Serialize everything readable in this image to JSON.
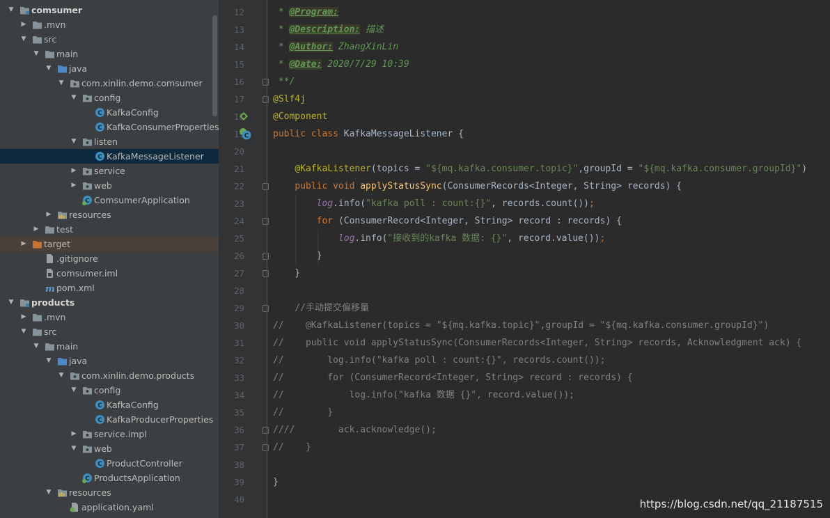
{
  "tree": [
    {
      "label": "comsumer",
      "icon": "module-folder-icon",
      "arrow": "▼",
      "level": 0,
      "bold": true
    },
    {
      "label": ".mvn",
      "icon": "folder-icon",
      "arrow": "▶",
      "level": 1
    },
    {
      "label": "src",
      "icon": "folder-icon",
      "arrow": "▼",
      "level": 1
    },
    {
      "label": "main",
      "icon": "folder-icon",
      "arrow": "▼",
      "level": 2
    },
    {
      "label": "java",
      "icon": "source-folder-icon",
      "arrow": "▼",
      "level": 3
    },
    {
      "label": "com.xinlin.demo.comsumer",
      "icon": "package-icon",
      "arrow": "▼",
      "level": 4
    },
    {
      "label": "config",
      "icon": "package-icon",
      "arrow": "▼",
      "level": 5
    },
    {
      "label": "KafkaConfig",
      "icon": "class-icon",
      "arrow": "",
      "level": 6
    },
    {
      "label": "KafkaConsumerProperties",
      "icon": "class-icon",
      "arrow": "",
      "level": 6
    },
    {
      "label": "listen",
      "icon": "package-icon",
      "arrow": "▼",
      "level": 5
    },
    {
      "label": "KafkaMessageListener",
      "icon": "class-icon",
      "arrow": "",
      "level": 6,
      "selected": true
    },
    {
      "label": "service",
      "icon": "package-icon",
      "arrow": "▶",
      "level": 5
    },
    {
      "label": "web",
      "icon": "package-icon",
      "arrow": "▶",
      "level": 5
    },
    {
      "label": "ComsumerApplication",
      "icon": "spring-class-icon",
      "arrow": "",
      "level": 5
    },
    {
      "label": "resources",
      "icon": "resources-folder-icon",
      "arrow": "▶",
      "level": 3
    },
    {
      "label": "test",
      "icon": "folder-icon",
      "arrow": "▶",
      "level": 2
    },
    {
      "label": "target",
      "icon": "excluded-folder-icon",
      "arrow": "▶",
      "level": 1,
      "highlight": true
    },
    {
      "label": ".gitignore",
      "icon": "file-icon",
      "arrow": "",
      "level": 2
    },
    {
      "label": "comsumer.iml",
      "icon": "iml-file-icon",
      "arrow": "",
      "level": 2
    },
    {
      "label": "pom.xml",
      "icon": "maven-icon",
      "arrow": "",
      "level": 2
    },
    {
      "label": "products",
      "icon": "module-folder-icon",
      "arrow": "▼",
      "level": 0,
      "bold": true
    },
    {
      "label": ".mvn",
      "icon": "folder-icon",
      "arrow": "▶",
      "level": 1
    },
    {
      "label": "src",
      "icon": "folder-icon",
      "arrow": "▼",
      "level": 1
    },
    {
      "label": "main",
      "icon": "folder-icon",
      "arrow": "▼",
      "level": 2
    },
    {
      "label": "java",
      "icon": "source-folder-icon",
      "arrow": "▼",
      "level": 3
    },
    {
      "label": "com.xinlin.demo.products",
      "icon": "package-icon",
      "arrow": "▼",
      "level": 4
    },
    {
      "label": "config",
      "icon": "package-icon",
      "arrow": "▼",
      "level": 5
    },
    {
      "label": "KafkaConfig",
      "icon": "class-icon",
      "arrow": "",
      "level": 6
    },
    {
      "label": "KafkaProducerProperties",
      "icon": "class-icon",
      "arrow": "",
      "level": 6
    },
    {
      "label": "service.impl",
      "icon": "package-icon",
      "arrow": "▶",
      "level": 5
    },
    {
      "label": "web",
      "icon": "package-icon",
      "arrow": "▼",
      "level": 5
    },
    {
      "label": "ProductController",
      "icon": "class-icon",
      "arrow": "",
      "level": 6
    },
    {
      "label": "ProductsApplication",
      "icon": "spring-class-icon",
      "arrow": "",
      "level": 5
    },
    {
      "label": "resources",
      "icon": "resources-folder-icon",
      "arrow": "▼",
      "level": 3
    },
    {
      "label": "application.yaml",
      "icon": "yaml-file-icon",
      "arrow": "",
      "level": 4
    }
  ],
  "lines": [
    {
      "n": "12",
      "tokens": [
        {
          "t": " * ",
          "c": "doc"
        },
        {
          "t": "@Program:",
          "c": "tag"
        }
      ]
    },
    {
      "n": "13",
      "tokens": [
        {
          "t": " * ",
          "c": "doc"
        },
        {
          "t": "@Description:",
          "c": "tag"
        },
        {
          "t": " 描述",
          "c": "doc"
        }
      ]
    },
    {
      "n": "14",
      "tokens": [
        {
          "t": " * ",
          "c": "doc"
        },
        {
          "t": "@Author:",
          "c": "tag"
        },
        {
          "t": " ZhangXinLin",
          "c": "doc"
        }
      ]
    },
    {
      "n": "15",
      "tokens": [
        {
          "t": " * ",
          "c": "doc"
        },
        {
          "t": "@Date:",
          "c": "tag"
        },
        {
          "t": " 2020/7/29 10:39",
          "c": "doc"
        }
      ]
    },
    {
      "n": "16",
      "tokens": [
        {
          "t": " **/",
          "c": "doc"
        }
      ]
    },
    {
      "n": "17",
      "tokens": [
        {
          "t": "@Slf4j",
          "c": "an"
        }
      ]
    },
    {
      "n": "18",
      "tokens": [
        {
          "t": "@Component",
          "c": "an"
        }
      ]
    },
    {
      "n": "19",
      "tokens": [
        {
          "t": "public class ",
          "c": "kw"
        },
        {
          "t": "KafkaMessageListener {",
          "c": ""
        }
      ]
    },
    {
      "n": "20",
      "tokens": []
    },
    {
      "n": "21",
      "tokens": [
        {
          "t": "    ",
          "c": ""
        },
        {
          "t": "@KafkaListener",
          "c": "an"
        },
        {
          "t": "(topics = ",
          "c": ""
        },
        {
          "t": "\"${mq.kafka.consumer.topic}\"",
          "c": "st"
        },
        {
          "t": ",groupId = ",
          "c": ""
        },
        {
          "t": "\"${mq.kafka.consumer.groupId}\"",
          "c": "st"
        },
        {
          "t": ")",
          "c": ""
        }
      ]
    },
    {
      "n": "22",
      "tokens": [
        {
          "t": "    ",
          "c": ""
        },
        {
          "t": "public void ",
          "c": "kw"
        },
        {
          "t": "applyStatusSync",
          "c": "fn"
        },
        {
          "t": "(ConsumerRecords<Integer, String> records) {",
          "c": ""
        }
      ]
    },
    {
      "n": "23",
      "tokens": [
        {
          "t": "        ",
          "c": ""
        },
        {
          "t": "log",
          "c": "it"
        },
        {
          "t": ".info(",
          "c": ""
        },
        {
          "t": "\"kafka poll : count:{}\"",
          "c": "st"
        },
        {
          "t": ", records.count())",
          "c": ""
        },
        {
          "t": ";",
          "c": "kw"
        }
      ]
    },
    {
      "n": "24",
      "tokens": [
        {
          "t": "        ",
          "c": ""
        },
        {
          "t": "for ",
          "c": "kw"
        },
        {
          "t": "(ConsumerRecord<Integer, String> record : records) {",
          "c": ""
        }
      ]
    },
    {
      "n": "25",
      "tokens": [
        {
          "t": "            ",
          "c": ""
        },
        {
          "t": "log",
          "c": "it"
        },
        {
          "t": ".info(",
          "c": ""
        },
        {
          "t": "\"接收到的kafka 数据: {}\"",
          "c": "st"
        },
        {
          "t": ", record.value())",
          "c": ""
        },
        {
          "t": ";",
          "c": "kw"
        }
      ]
    },
    {
      "n": "26",
      "tokens": [
        {
          "t": "        }",
          "c": ""
        }
      ]
    },
    {
      "n": "27",
      "tokens": [
        {
          "t": "    }",
          "c": ""
        }
      ]
    },
    {
      "n": "28",
      "tokens": []
    },
    {
      "n": "29",
      "tokens": [
        {
          "t": "    //手动提交偏移量",
          "c": "cm"
        }
      ]
    },
    {
      "n": "30",
      "tokens": [
        {
          "t": "//    @KafkaListener(topics = \"${mq.kafka.topic}\",groupId = \"${mq.kafka.consumer.groupId}\")",
          "c": "cm"
        }
      ]
    },
    {
      "n": "31",
      "tokens": [
        {
          "t": "//    public void applyStatusSync(ConsumerRecords<Integer, String> records, Acknowledgment ack) {",
          "c": "cm"
        }
      ]
    },
    {
      "n": "32",
      "tokens": [
        {
          "t": "//        log.info(\"kafka poll : count:{}\", records.count());",
          "c": "cm"
        }
      ]
    },
    {
      "n": "33",
      "tokens": [
        {
          "t": "//        for (ConsumerRecord<Integer, String> record : records) {",
          "c": "cm"
        }
      ]
    },
    {
      "n": "34",
      "tokens": [
        {
          "t": "//            log.info(\"kafka 数据 {}\", record.value());",
          "c": "cm"
        }
      ]
    },
    {
      "n": "35",
      "tokens": [
        {
          "t": "//        }",
          "c": "cm"
        }
      ]
    },
    {
      "n": "36",
      "tokens": [
        {
          "t": "////        ack.acknowledge();",
          "c": "cm"
        }
      ]
    },
    {
      "n": "37",
      "tokens": [
        {
          "t": "//    }",
          "c": "cm"
        }
      ]
    },
    {
      "n": "38",
      "tokens": []
    },
    {
      "n": "39",
      "tokens": [
        {
          "t": "}",
          "c": ""
        }
      ]
    },
    {
      "n": "40",
      "tokens": []
    }
  ],
  "watermark": "https://blog.csdn.net/qq_21187515",
  "colors": {
    "tree_bg": "#3c3f41",
    "editor_bg": "#2b2b2b",
    "gutter_bg": "#313335",
    "selection": "#0d293e",
    "keyword": "#cc7832",
    "string": "#6a8759",
    "annotation": "#bbb529",
    "comment": "#808080",
    "method": "#ffc66d"
  }
}
